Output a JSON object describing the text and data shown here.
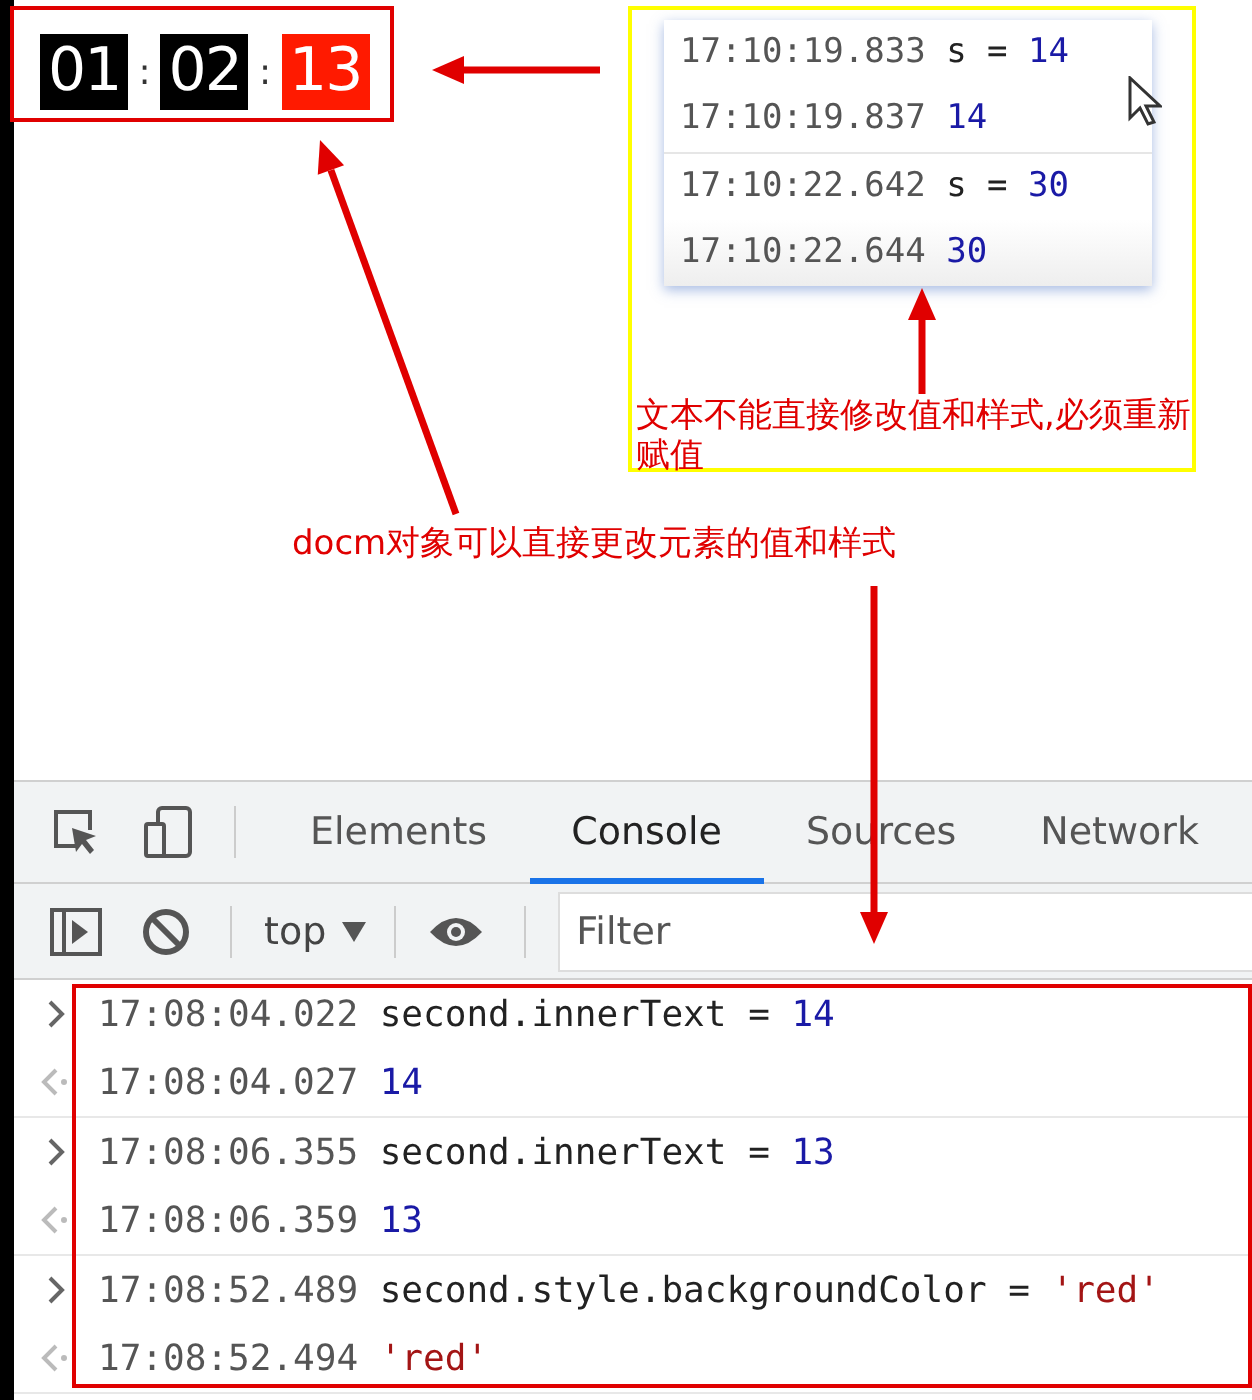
{
  "timer": {
    "segments": [
      {
        "text": "01",
        "highlighted": false
      },
      {
        "text": ":",
        "kind": "separator"
      },
      {
        "text": "02",
        "highlighted": false
      },
      {
        "text": ":",
        "kind": "separator"
      },
      {
        "text": "13",
        "highlighted": true
      }
    ]
  },
  "snippet": {
    "groups": [
      {
        "entries": [
          {
            "time": "17:10:19.833",
            "code": "s = ",
            "value": {
              "text": "14",
              "color": "#1a1aa6"
            }
          },
          {
            "time": "17:10:19.837",
            "value": {
              "text": "14",
              "color": "#1a1aa6"
            }
          }
        ]
      },
      {
        "entries": [
          {
            "time": "17:10:22.642",
            "code": "s = ",
            "value": {
              "text": "30",
              "color": "#1a1aa6"
            }
          },
          {
            "time": "17:10:22.644",
            "value": {
              "text": "30",
              "color": "#1a1aa6"
            }
          }
        ]
      }
    ]
  },
  "annotations": [
    {
      "kind": "top",
      "text": "文本不能直接修改值和样式,必须重新赋值"
    },
    {
      "kind": "middle",
      "text": "docm对象可以直接更改元素的值和样式"
    }
  ],
  "devtools": {
    "tabs": [
      {
        "label": "Elements",
        "selected": false
      },
      {
        "label": "Console",
        "selected": true
      },
      {
        "label": "Sources",
        "selected": false
      },
      {
        "label": "Network",
        "selected": false
      }
    ],
    "context": "top",
    "filter": {
      "placeholder": "Filter"
    }
  },
  "console": {
    "groups": [
      {
        "entries": [
          {
            "kind": "input",
            "time": "17:08:04.022",
            "code": "second.innerText = ",
            "value": {
              "text": "14",
              "color": "#1a1aa6"
            }
          },
          {
            "kind": "output",
            "time": "17:08:04.027",
            "value": {
              "text": "14",
              "color": "#1a1aa6"
            }
          }
        ]
      },
      {
        "entries": [
          {
            "kind": "input",
            "time": "17:08:06.355",
            "code": "second.innerText = ",
            "value": {
              "text": "13",
              "color": "#1a1aa6"
            }
          },
          {
            "kind": "output",
            "time": "17:08:06.359",
            "value": {
              "text": "13",
              "color": "#1a1aa6"
            }
          }
        ]
      },
      {
        "entries": [
          {
            "kind": "input",
            "time": "17:08:52.489",
            "code": "second.style.backgroundColor = ",
            "value": {
              "text": "'red'",
              "color": "#a31515"
            }
          },
          {
            "kind": "output",
            "time": "17:08:52.494",
            "value": {
              "text": "'red'",
              "color": "#a31515"
            }
          }
        ]
      }
    ]
  }
}
